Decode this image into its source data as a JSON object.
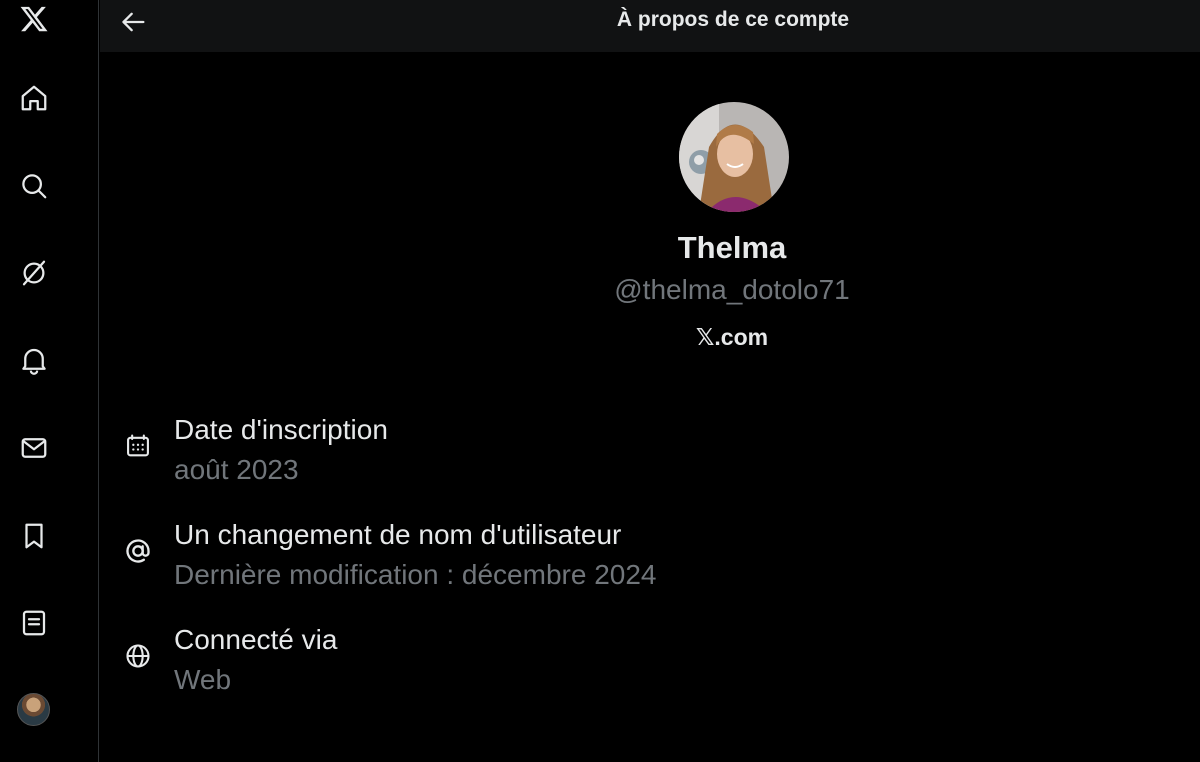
{
  "header": {
    "title": "À propos de ce compte",
    "back_icon": "arrow-left-icon"
  },
  "sidebar": {
    "logo_icon": "x-logo-icon",
    "items": [
      {
        "icon": "home-icon"
      },
      {
        "icon": "search-icon"
      },
      {
        "icon": "grok-icon"
      },
      {
        "icon": "bell-icon"
      },
      {
        "icon": "mail-icon"
      },
      {
        "icon": "bookmark-icon"
      },
      {
        "icon": "list-icon"
      }
    ],
    "avatar_icon": "avatar"
  },
  "profile": {
    "display_name": "Thelma",
    "handle": "@thelma_dotolo71",
    "site": "𝕏.com"
  },
  "info": [
    {
      "icon": "calendar-icon",
      "label": "Date d'inscription",
      "value": "août 2023"
    },
    {
      "icon": "at-icon",
      "label": "Un changement de nom d'utilisateur",
      "value": "Dernière modification : décembre 2024"
    },
    {
      "icon": "globe-icon",
      "label": "Connecté via",
      "value": "Web"
    }
  ],
  "colors": {
    "background": "#000000",
    "header_bg": "#111213",
    "primary_text": "#e7e9ea",
    "secondary_text": "#71767b",
    "border": "#2f3336"
  }
}
